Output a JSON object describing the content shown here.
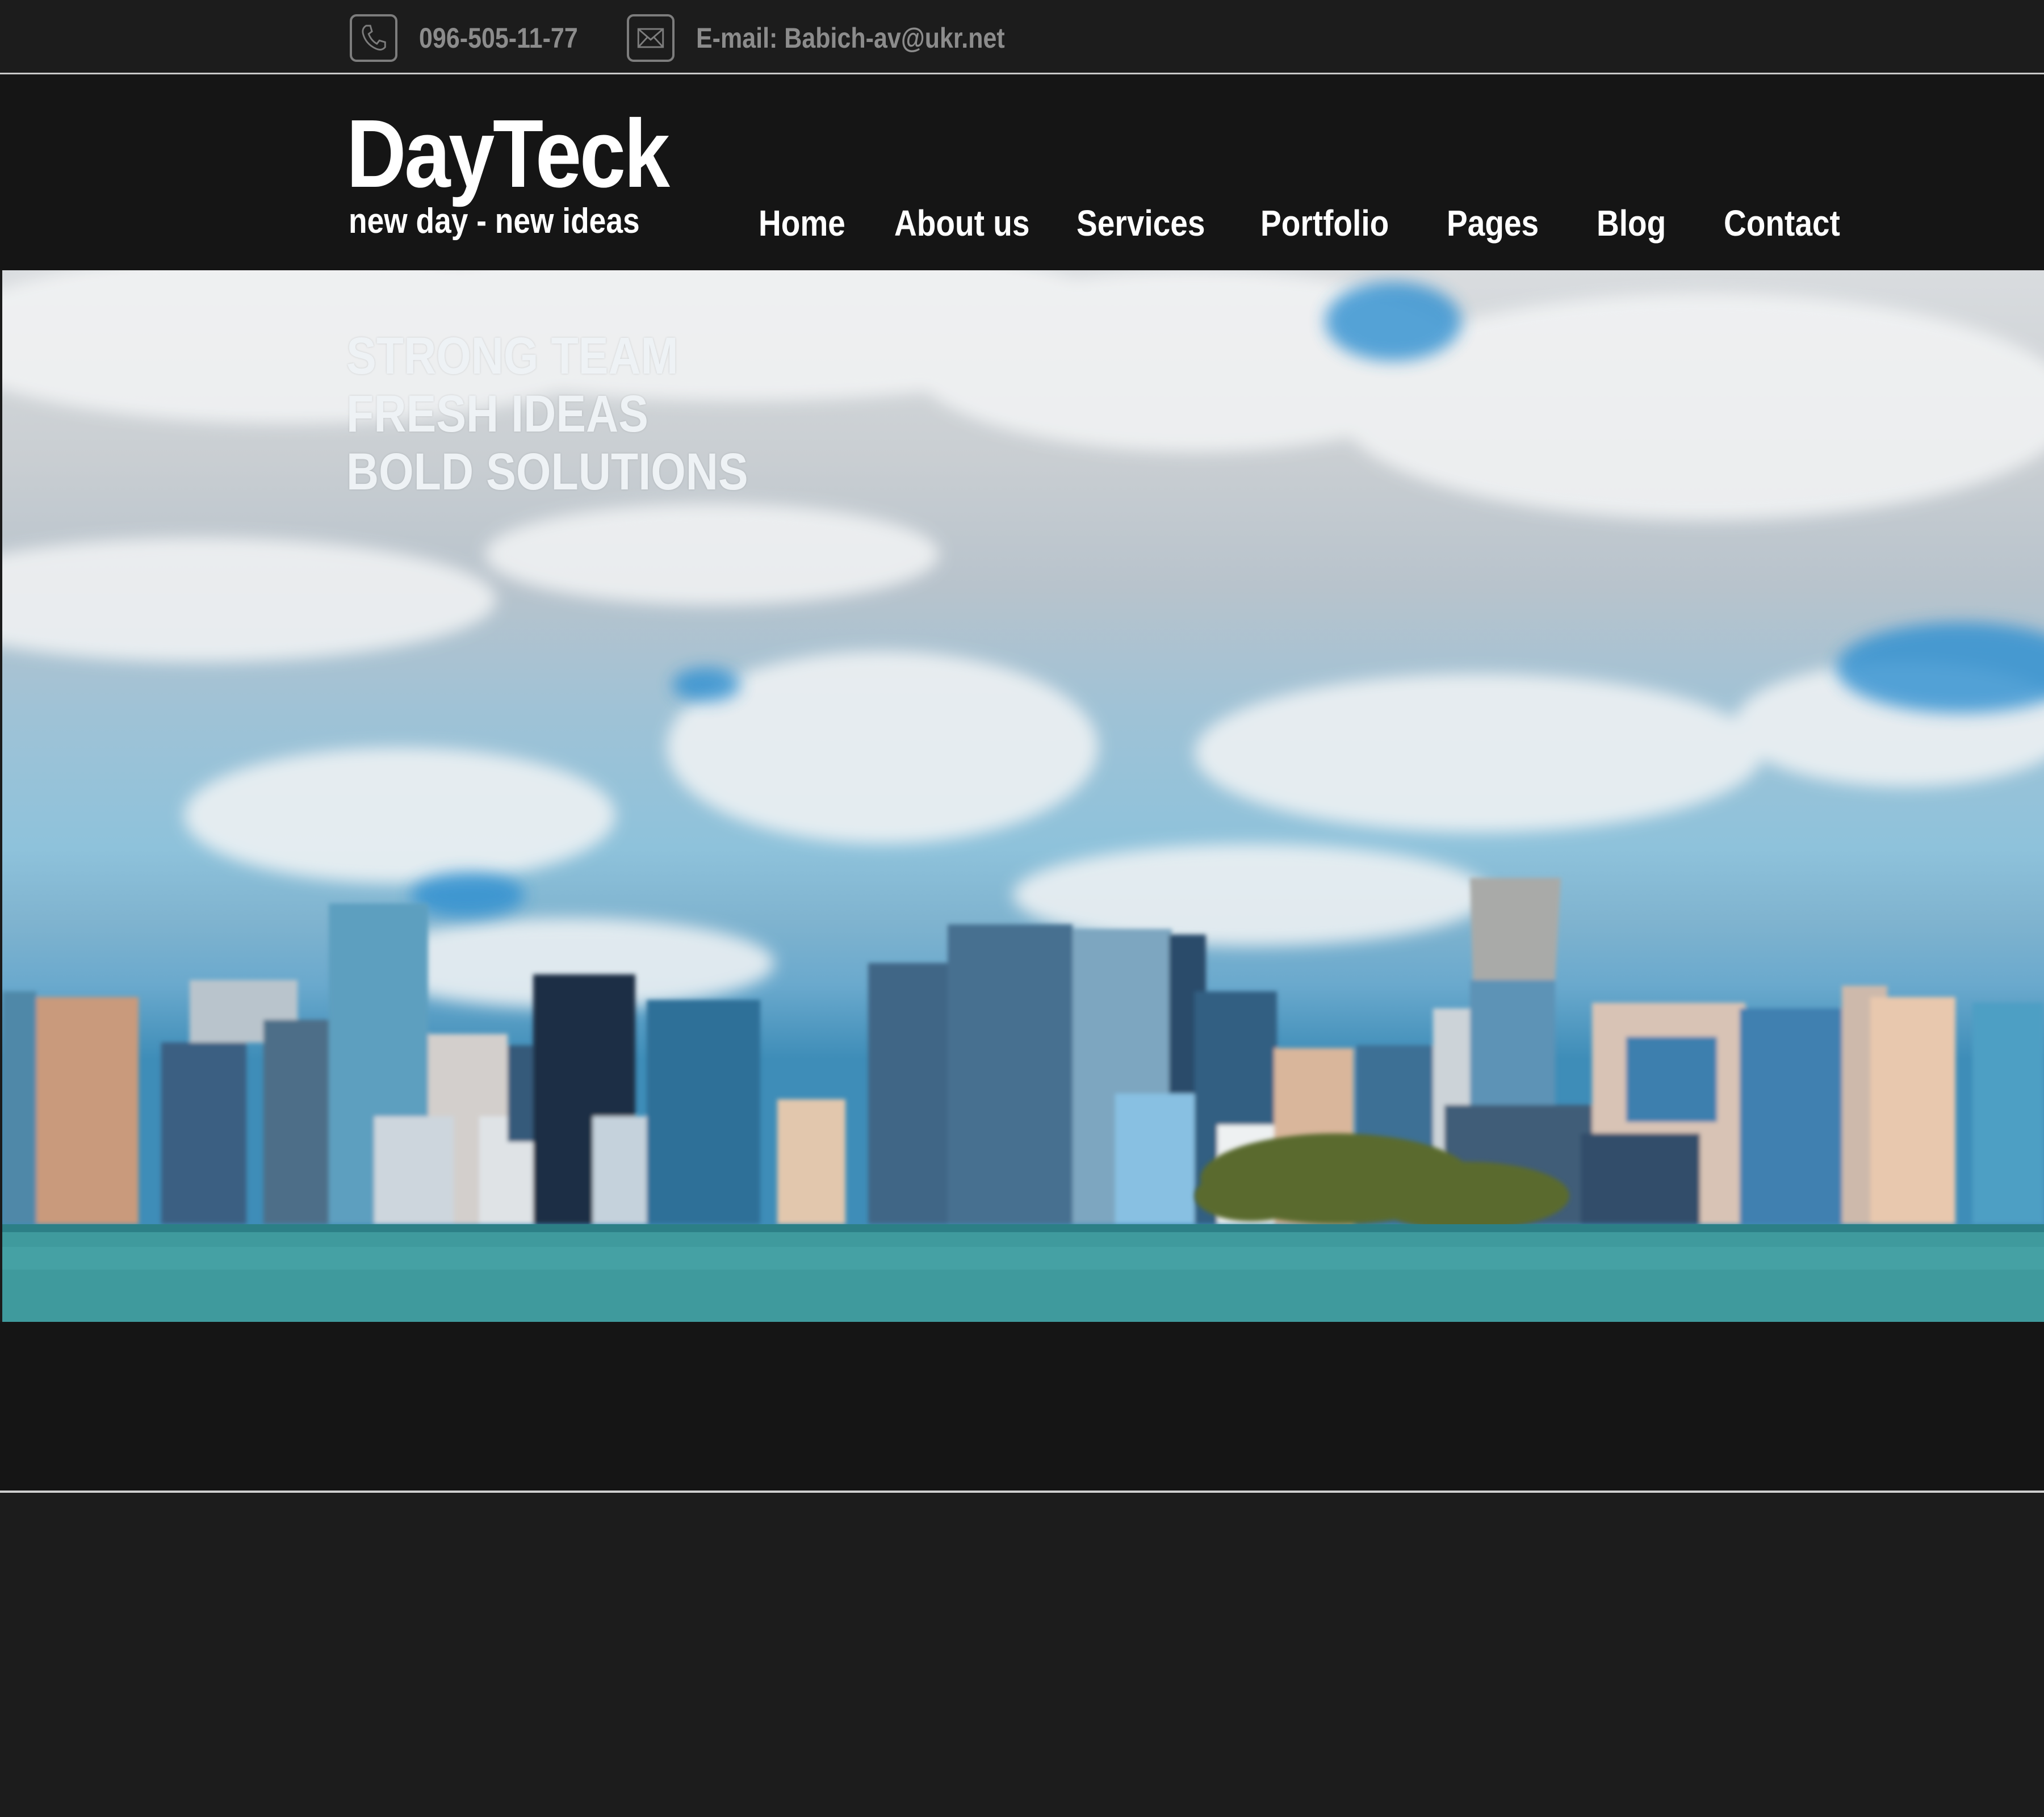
{
  "contacts": {
    "phone": "096-505-11-77",
    "email": "E-mail: Babich-av@ukr.net"
  },
  "brand": {
    "logo": "DayTeck",
    "tagline": "new day - new ideas"
  },
  "nav": {
    "items": [
      "Home",
      "About us",
      "Services",
      "Portfolio",
      "Pages",
      "Blog",
      "Contact"
    ]
  },
  "hero": {
    "lines": [
      "STRONG TEAM",
      "FRESH IDEAS",
      "BOLD SOLUTIONS"
    ]
  },
  "colors": {
    "background": "#1b1b1b",
    "header": "#151515",
    "text": "#ffffff",
    "muted": "#8c8c8c"
  }
}
